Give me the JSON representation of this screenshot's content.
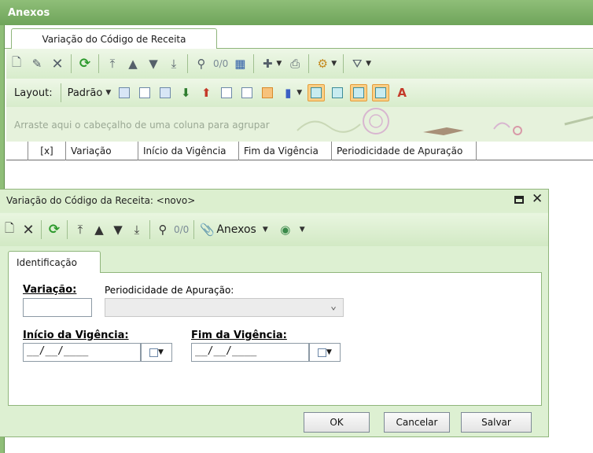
{
  "bg_window": {
    "title": "Anexos",
    "tab": "Variação do Código de Receita",
    "toolbar1": {
      "counter": "0/0"
    },
    "toolbar2": {
      "layout_label": "Layout:",
      "layout_value": "Padrão"
    },
    "group_panel_text": "Arraste aqui o cabeçalho de uma coluna para agrupar",
    "columns": [
      "[x]",
      "Variação",
      "Início da Vigência",
      "Fim da Vigência",
      "Periodicidade de Apuração"
    ]
  },
  "dialog": {
    "title": "Variação do Código da Receita: <novo>",
    "toolbar": {
      "counter": "0/0",
      "attachments_label": "Anexos"
    },
    "tab": "Identificação",
    "form": {
      "variacao_label": "Variação:",
      "variacao_value": "",
      "periodicidade_label": "Periodicidade de Apuração:",
      "periodicidade_value": "",
      "inicio_label": "Início da Vigência:",
      "inicio_value": "__/__/____",
      "fim_label": "Fim da Vigência:",
      "fim_value": "__/__/____"
    },
    "buttons": {
      "ok": "OK",
      "cancel": "Cancelar",
      "save": "Salvar"
    }
  },
  "colors": {
    "title_bar": "#8fbe78",
    "dialog_bg": "#ddf0d2",
    "highlight": "#fbcf86",
    "refresh_green": "#2d9a2d"
  }
}
